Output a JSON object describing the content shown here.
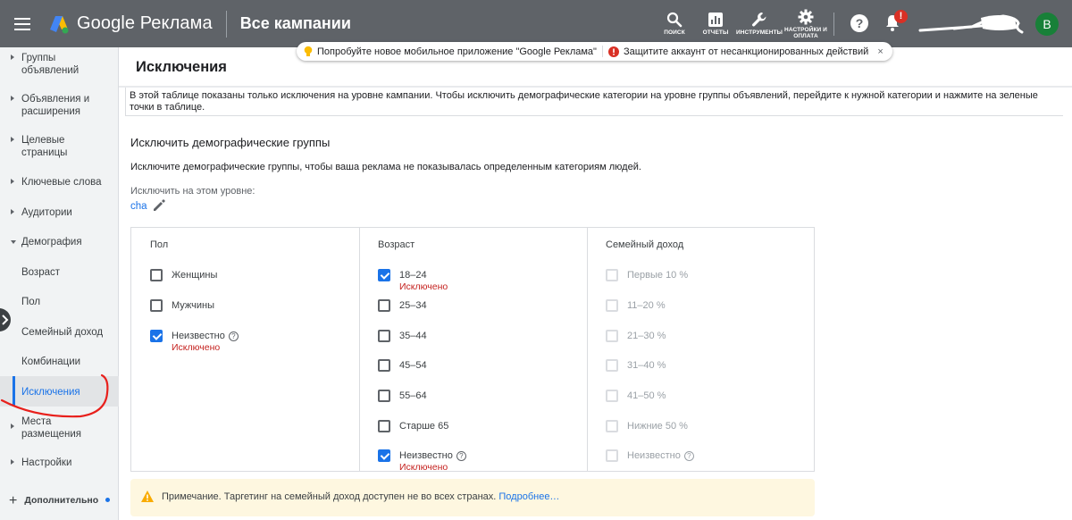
{
  "header": {
    "brand": "Google Реклама",
    "page_name": "Все кампании",
    "tools": [
      {
        "label": "ПОИСК",
        "icon": "search-icon"
      },
      {
        "label": "ОТЧЕТЫ",
        "icon": "reports-icon"
      },
      {
        "label": "ИНСТРУМЕНТЫ",
        "icon": "wrench-icon"
      },
      {
        "label": "НАСТРОЙКИ И ОПЛАТА",
        "icon": "gear-icon"
      }
    ],
    "help": "?",
    "bell_badge": "!",
    "avatar_letter": "B"
  },
  "notices": {
    "app": "Попробуйте новое мобильное приложение \"Google Реклама\"",
    "security": "Защитите аккаунт от несанкционированных действий",
    "close": "×"
  },
  "sidebar": {
    "items": [
      {
        "label1": "Группы",
        "label2": "объявлений"
      },
      {
        "label1": "Объявления и",
        "label2": "расширения"
      },
      {
        "label1": "Целевые",
        "label2": "страницы"
      },
      {
        "label1": "Ключевые слова"
      },
      {
        "label1": "Аудитории"
      },
      {
        "label1": "Демография"
      }
    ],
    "sub_items": [
      "Возраст",
      "Пол",
      "Семейный доход",
      "Комбинации",
      "Исключения"
    ],
    "tail_items": [
      {
        "label1": "Места",
        "label2": "размещения"
      },
      {
        "label1": "Настройки"
      }
    ],
    "more": "Дополнительно"
  },
  "main": {
    "title": "Исключения",
    "info": "В этой таблице показаны только исключения на уровне кампании. Чтобы исключить демографические категории на уровне группы объявлений, перейдите к нужной категории и нажмите на зеленые точки в таблице.",
    "section_title": "Исключить демографические группы",
    "section_desc": "Исключите демографические группы, чтобы ваша реклама не показывалась определенным категориям людей.",
    "level_label": "Исключить на этом уровне:",
    "level_value": "cha",
    "excluded_text": "Исключено",
    "columns": [
      {
        "title": "Пол",
        "options": [
          {
            "label": "Женщины",
            "checked": false
          },
          {
            "label": "Мужчины",
            "checked": false
          },
          {
            "label": "Неизвестно",
            "checked": true,
            "help": "?"
          }
        ]
      },
      {
        "title": "Возраст",
        "options": [
          {
            "label": "18–24",
            "checked": true
          },
          {
            "label": "25–34",
            "checked": false
          },
          {
            "label": "35–44",
            "checked": false
          },
          {
            "label": "45–54",
            "checked": false
          },
          {
            "label": "55–64",
            "checked": false
          },
          {
            "label": "Старше 65",
            "checked": false
          },
          {
            "label": "Неизвестно",
            "checked": true,
            "help": "?"
          }
        ]
      },
      {
        "title": "Семейный доход",
        "options": [
          {
            "label": "Первые 10 %",
            "checked": false
          },
          {
            "label": "11–20 %",
            "checked": false
          },
          {
            "label": "21–30 %",
            "checked": false
          },
          {
            "label": "31–40 %",
            "checked": false
          },
          {
            "label": "41–50 %",
            "checked": false
          },
          {
            "label": "Нижние 50 %",
            "checked": false
          },
          {
            "label": "Неизвестно",
            "checked": false,
            "help": "?"
          }
        ]
      }
    ],
    "note_text": "Примечание. Таргетинг на семейный доход доступен не во всех странах.",
    "note_link": "Подробнее…"
  },
  "colors": {
    "header_bg": "#5f6368",
    "accent": "#1a73e8",
    "excluded": "#c5221f",
    "note_bg": "#fef7e0",
    "annotation": "#e8201c"
  }
}
